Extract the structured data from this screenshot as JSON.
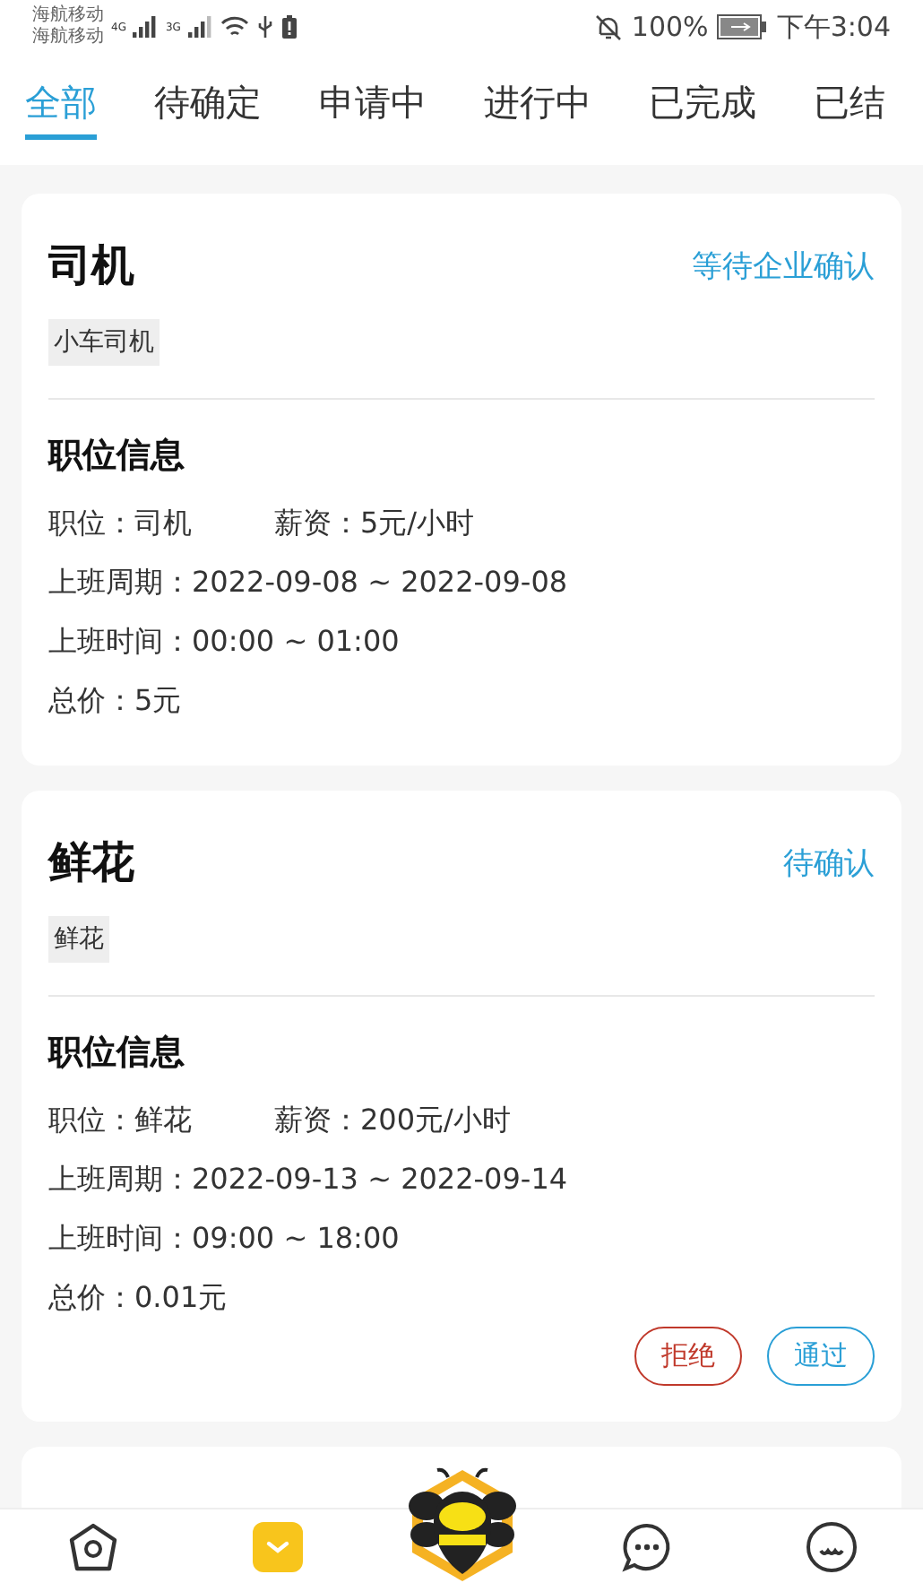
{
  "status_bar": {
    "carriers": [
      "海航移动",
      "海航移动"
    ],
    "networks": [
      "4G",
      "3G"
    ],
    "battery": "100%",
    "time": "下午3:04"
  },
  "tabs": [
    {
      "label": "全部",
      "selected": true
    },
    {
      "label": "待确定",
      "selected": false
    },
    {
      "label": "申请中",
      "selected": false
    },
    {
      "label": "进行中",
      "selected": false
    },
    {
      "label": "已完成",
      "selected": false
    },
    {
      "label": "已结",
      "selected": false
    }
  ],
  "orders": [
    {
      "title": "司机",
      "status": "等待企业确认",
      "tag": "小车司机",
      "section": "职位信息",
      "position": "职位：司机",
      "salary": "薪资：5元/小时",
      "period": "上班周期：2022-09-08 ~ 2022-09-08",
      "hours": "上班时间：00:00 ~ 01:00",
      "total": "总价：5元"
    },
    {
      "title": "鲜花",
      "status": "待确认",
      "tag": "鲜花",
      "section": "职位信息",
      "position": "职位：鲜花",
      "salary": "薪资：200元/小时",
      "period": "上班周期：2022-09-13 ~ 2022-09-14",
      "hours": "上班时间：09:00 ~ 18:00",
      "total": "总价：0.01元",
      "actions": [
        {
          "label": "拒绝",
          "kind": "reject"
        },
        {
          "label": "通过",
          "kind": "accept"
        }
      ]
    }
  ],
  "nav": [
    {
      "kind": "home"
    },
    {
      "kind": "orders",
      "selected": true
    },
    {
      "kind": "bee"
    },
    {
      "kind": "chat"
    },
    {
      "kind": "profile"
    }
  ]
}
